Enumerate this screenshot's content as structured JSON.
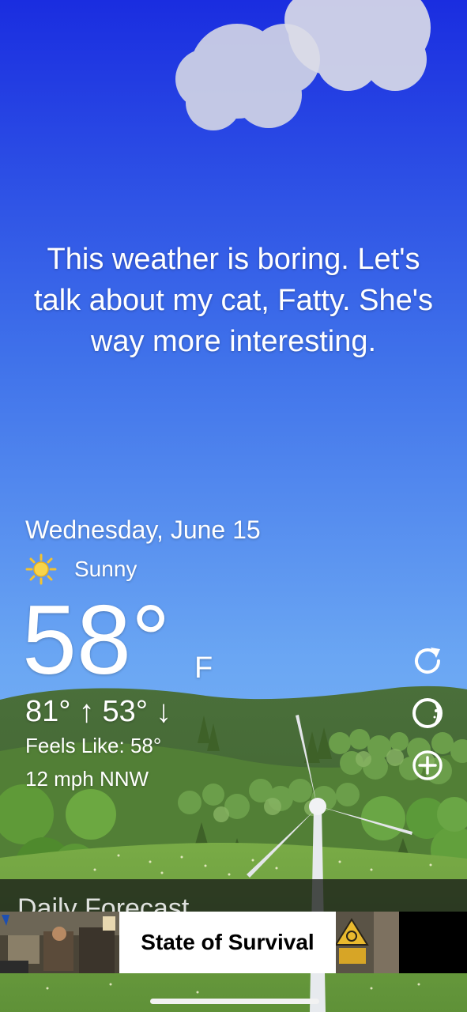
{
  "message": "This weather is boring. Let's talk about my cat, Fatty. She's way more interesting.",
  "date": "Wednesday, June 15",
  "condition": {
    "label": "Sunny",
    "icon": "sun-icon"
  },
  "temperature": {
    "current": "58°",
    "unit": "F",
    "high": "81°",
    "low": "53°",
    "high_arrow": "↑",
    "low_arrow": "↓"
  },
  "feels_like": "Feels Like: 58°",
  "wind": "12 mph NNW",
  "forecast_peek": "Daily Forecast",
  "controls": {
    "refresh_icon": "refresh-icon",
    "theme_icon": "moon-phase-icon",
    "add_icon": "add-location-icon"
  },
  "ad": {
    "text": "State of Survival"
  },
  "colors": {
    "sky_top": "#1a2fe0",
    "sky_bottom": "#6fb0f4",
    "hills": "#4f7a35",
    "grass": "#6ea040"
  }
}
